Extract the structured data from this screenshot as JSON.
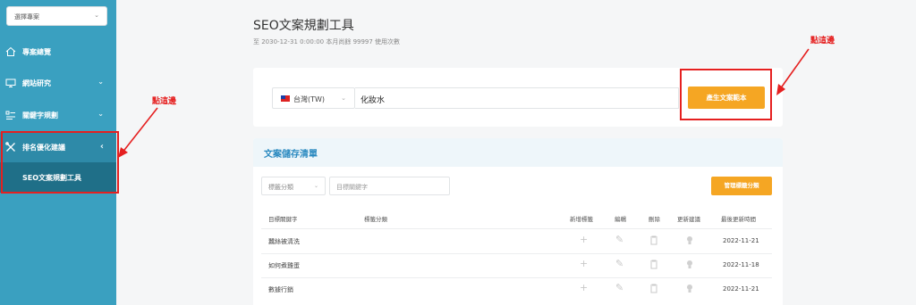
{
  "sidebar": {
    "project_select": "選擇專案",
    "items": [
      {
        "label": "專案總覽",
        "icon": "home-icon",
        "arrow": ""
      },
      {
        "label": "網站研究",
        "icon": "monitor-icon",
        "arrow": "⌄"
      },
      {
        "label": "關鍵字規劃",
        "icon": "list-icon",
        "arrow": "⌄"
      },
      {
        "label": "排名優化建議",
        "icon": "tools-icon",
        "arrow": "‹"
      }
    ],
    "subitem": "SEO文案規劃工具"
  },
  "header": {
    "title": "SEO文案規劃工具",
    "subtitle": "至 2030-12-31 0:00:00 本月尚餘 99997 使用次數"
  },
  "generator": {
    "region": "台灣(TW)",
    "keyword": "化妝水",
    "button": "產生文案範本"
  },
  "annotations": {
    "left": "點這邊",
    "right": "點這邊"
  },
  "list": {
    "title": "文案儲存清單",
    "filter_select": "標籤分類",
    "filter_input": "目標關鍵字",
    "manage_button": "管理標籤分類",
    "columns": [
      "目標關鍵字",
      "標籤分類",
      "新增標籤",
      "編輯",
      "刪除",
      "更新建議",
      "最後更新時間"
    ],
    "rows": [
      {
        "keyword": "蠶絲被清洗",
        "tag": "",
        "updated": "2022-11-21"
      },
      {
        "keyword": "如何煮雞蛋",
        "tag": "",
        "updated": "2022-11-18"
      },
      {
        "keyword": "數據行銷",
        "tag": "",
        "updated": "2022-11-21"
      }
    ]
  },
  "colors": {
    "sidebar": "#3aa0c0",
    "accent": "#f5a623",
    "annotation": "#e52020",
    "title_blue": "#2b8ac0"
  }
}
